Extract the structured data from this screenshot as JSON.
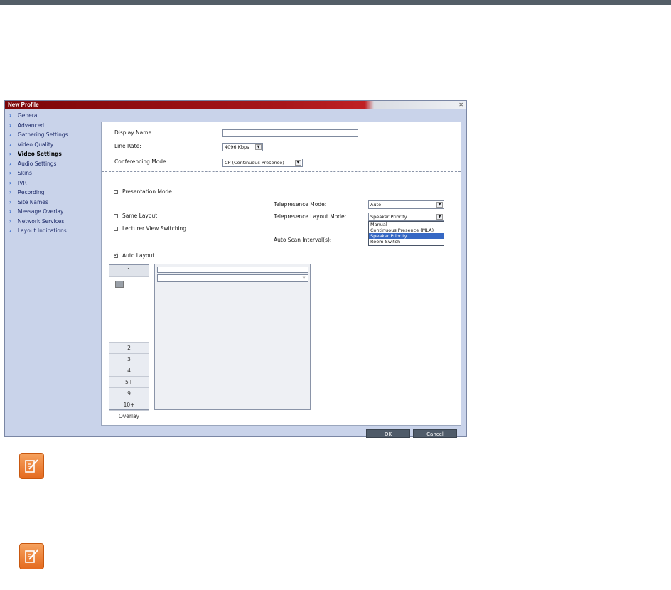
{
  "dialog": {
    "title": "New Profile",
    "close_glyph": "✕",
    "nav_items": [
      {
        "label": "General"
      },
      {
        "label": "Advanced"
      },
      {
        "label": "Gathering Settings"
      },
      {
        "label": "Video Quality"
      },
      {
        "label": "Video Settings",
        "active": true
      },
      {
        "label": "Audio Settings"
      },
      {
        "label": "Skins"
      },
      {
        "label": "IVR"
      },
      {
        "label": "Recording"
      },
      {
        "label": "Site Names"
      },
      {
        "label": "Message Overlay"
      },
      {
        "label": "Network Services"
      },
      {
        "label": "Layout Indications"
      }
    ],
    "form": {
      "display_name_label": "Display Name:",
      "display_name_value": "",
      "line_rate_label": "Line Rate:",
      "line_rate_value": "4096 Kbps",
      "conferencing_mode_label": "Conferencing Mode:",
      "conferencing_mode_value": "CP (Continuous Presence)",
      "presentation_mode_label": "Presentation Mode",
      "presentation_mode_checked": false,
      "telepresence_mode_label": "Telepresence Mode:",
      "telepresence_mode_value": "Auto",
      "same_layout_label": "Same Layout",
      "same_layout_checked": false,
      "telepresence_layout_mode_label": "Telepresence Layout Mode:",
      "telepresence_layout_mode_value": "Speaker Priority",
      "telepresence_layout_options": [
        "Manual",
        "Continuous Presence (MLA)",
        "Speaker Priority",
        "Room Switch"
      ],
      "telepresence_layout_selected_index": 2,
      "lecturer_view_label": "Lecturer View Switching",
      "lecturer_view_checked": false,
      "auto_scan_label": "Auto Scan Interval(s):",
      "auto_layout_label": "Auto Layout",
      "auto_layout_checked": true
    },
    "layout_tabs": [
      "1",
      "2",
      "3",
      "4",
      "5+",
      "9",
      "10+",
      "Overlay"
    ],
    "buttons": {
      "ok": "OK",
      "cancel": "Cancel"
    }
  },
  "colors": {
    "titlebar": "#a8161a",
    "dialog_bg": "#c9d3ea",
    "nav_chevron": "#2b63c8",
    "selected_option": "#3668c4",
    "note_icon": "#e46a1f"
  },
  "icons": [
    "chevron-right-icon",
    "close-icon",
    "note-icon"
  ]
}
